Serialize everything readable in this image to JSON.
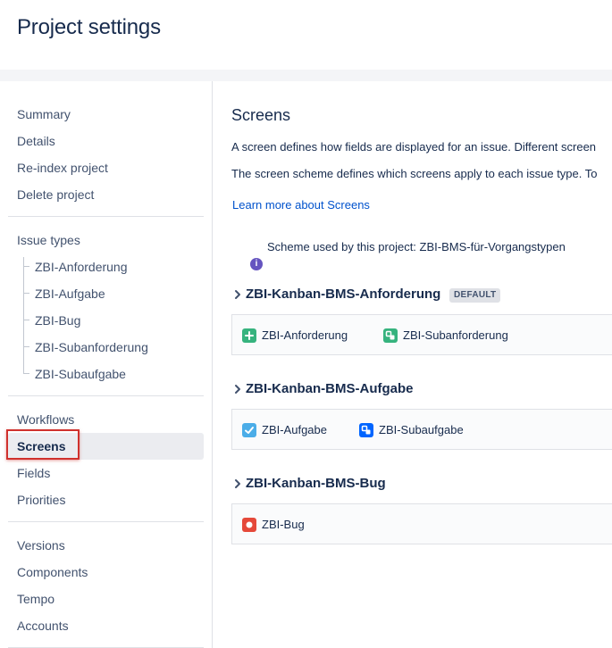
{
  "header": {
    "title": "Project settings"
  },
  "sidebar": {
    "top_items": [
      {
        "label": "Summary"
      },
      {
        "label": "Details"
      },
      {
        "label": "Re-index project"
      },
      {
        "label": "Delete project"
      }
    ],
    "issue_types_heading": "Issue types",
    "issue_types": [
      {
        "label": "ZBI-Anforderung"
      },
      {
        "label": "ZBI-Aufgabe"
      },
      {
        "label": "ZBI-Bug"
      },
      {
        "label": "ZBI-Subanforderung"
      },
      {
        "label": "ZBI-Subaufgabe"
      }
    ],
    "config_items": [
      {
        "label": "Workflows"
      },
      {
        "label": "Screens",
        "active": true
      },
      {
        "label": "Fields"
      },
      {
        "label": "Priorities"
      }
    ],
    "more_items": [
      {
        "label": "Versions"
      },
      {
        "label": "Components"
      },
      {
        "label": "Tempo"
      },
      {
        "label": "Accounts"
      }
    ]
  },
  "main": {
    "title": "Screens",
    "description_1": "A screen defines how fields are displayed for an issue. Different screen",
    "description_2": "The screen scheme defines which screens apply to each issue type. To",
    "learn_more": "Learn more about Screens",
    "scheme_used": "Scheme used by this project: ZBI-BMS-für-Vorgangstypen",
    "info_icon": "i",
    "schemes": [
      {
        "name": "ZBI-Kanban-BMS-Anforderung",
        "badge": "DEFAULT",
        "issue_types": [
          {
            "label": "ZBI-Anforderung",
            "icon": "plus-icon",
            "color": "#36b37e"
          },
          {
            "label": "ZBI-Subanforderung",
            "icon": "subtask-icon",
            "color": "#36b37e"
          }
        ]
      },
      {
        "name": "ZBI-Kanban-BMS-Aufgabe",
        "issue_types": [
          {
            "label": "ZBI-Aufgabe",
            "icon": "checkbox-icon",
            "color": "#4bade8"
          },
          {
            "label": "ZBI-Subaufgabe",
            "icon": "subtask-icon",
            "color": "#0065ff"
          }
        ]
      },
      {
        "name": "ZBI-Kanban-BMS-Bug",
        "issue_types": [
          {
            "label": "ZBI-Bug",
            "icon": "bug-icon",
            "color": "#e5493a"
          }
        ]
      }
    ]
  },
  "colors": {
    "text": "#172b4d",
    "nav_text": "#42526e",
    "link": "#0052cc",
    "highlight": "#d0312d"
  }
}
